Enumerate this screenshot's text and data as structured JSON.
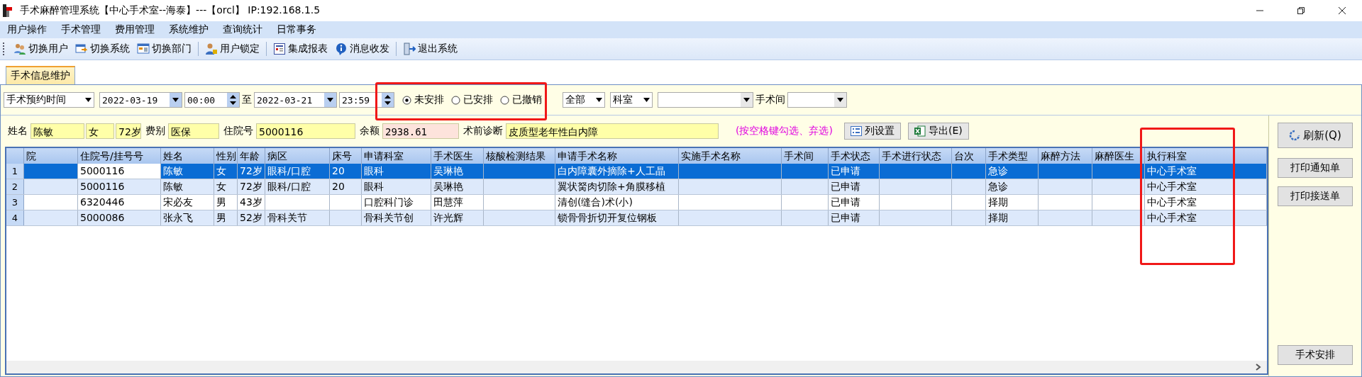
{
  "window": {
    "title": "手术麻醉管理系统【中心手术室--海泰】---【orcl】 IP:192.168.1.5"
  },
  "menu": [
    "用户操作",
    "手术管理",
    "费用管理",
    "系统维护",
    "查询统计",
    "日常事务"
  ],
  "toolbar": [
    {
      "kind": "users",
      "label": "切换用户"
    },
    {
      "kind": "system",
      "label": "切换系统"
    },
    {
      "kind": "dept",
      "label": "切换部门"
    },
    {
      "kind": "lock",
      "label": "用户锁定"
    },
    {
      "kind": "report",
      "label": "集成报表"
    },
    {
      "kind": "info",
      "label": "消息收发"
    },
    {
      "kind": "exit",
      "label": "退出系统"
    }
  ],
  "tabs": [
    {
      "label": "手术信息维护",
      "selected": true
    }
  ],
  "filter": {
    "time_type": "手术预约时间",
    "start_date": "2022-03-19",
    "start_time": "00:00",
    "to": "至",
    "end_date": "2022-03-21",
    "end_time": "23:59",
    "statuses": [
      {
        "label": "未安排",
        "selected": true
      },
      {
        "label": "已安排",
        "selected": false
      },
      {
        "label": "已撤销",
        "selected": false
      }
    ],
    "scope": "全部",
    "dept_type": "科室",
    "room_label": "手术间"
  },
  "patient": [
    {
      "kind": "label",
      "text": "姓名"
    },
    {
      "kind": "field",
      "text": "陈敏"
    },
    {
      "kind": "field",
      "text": "女"
    },
    {
      "kind": "field",
      "text": "72岁"
    },
    {
      "kind": "label",
      "text": "费别"
    },
    {
      "kind": "field",
      "text": "医保"
    },
    {
      "kind": "label",
      "text": "住院号"
    },
    {
      "kind": "field",
      "text": "5000116"
    },
    {
      "kind": "label",
      "text": "余额"
    },
    {
      "kind": "warn",
      "text": "2938.61"
    },
    {
      "kind": "label",
      "text": "术前诊断"
    },
    {
      "kind": "wide",
      "text": "皮质型老年性白内障"
    }
  ],
  "hint": "(按空格键勾选、弃选)",
  "actions": [
    {
      "kind": "columns",
      "label": "列设置"
    },
    {
      "kind": "excel",
      "label": "导出(E)"
    }
  ],
  "table": {
    "columns": [
      "院",
      "住院号/挂号号",
      "姓名",
      "性别",
      "年龄",
      "病区",
      "床号",
      "申请科室",
      "手术医生",
      "核酸检测结果",
      "申请手术名称",
      "实施手术名称",
      "手术间",
      "手术状态",
      "手术进行状态",
      "台次",
      "手术类型",
      "麻醉方法",
      "麻醉医生",
      "执行科室"
    ],
    "rows": [
      {
        "index": "1",
        "selected": true,
        "cells": [
          null,
          "5000116",
          "陈敏",
          "女",
          "72岁",
          "眼科/口腔",
          "20",
          "眼科",
          "吴琳艳",
          null,
          "白内障囊外摘除+人工晶",
          null,
          null,
          "已申请",
          null,
          null,
          "急诊",
          null,
          null,
          "中心手术室"
        ]
      },
      {
        "index": "2",
        "selected": false,
        "cells": [
          null,
          "5000116",
          "陈敏",
          "女",
          "72岁",
          "眼科/口腔",
          "20",
          "眼科",
          "吴琳艳",
          null,
          "翼状胬肉切除+角膜移植",
          null,
          null,
          "已申请",
          null,
          null,
          "急诊",
          null,
          null,
          "中心手术室"
        ]
      },
      {
        "index": "3",
        "selected": false,
        "cells": [
          null,
          "6320446",
          "宋必友",
          "男",
          "43岁",
          null,
          null,
          "口腔科门诊",
          "田慧萍",
          null,
          "清创(缝合)术(小)",
          null,
          null,
          "已申请",
          null,
          null,
          "择期",
          null,
          null,
          "中心手术室"
        ]
      },
      {
        "index": "4",
        "selected": false,
        "cells": [
          null,
          "5000086",
          "张永飞",
          "男",
          "52岁",
          "骨科关节",
          null,
          "骨科关节创",
          "许光辉",
          null,
          "锁骨骨折切开复位钢板",
          null,
          null,
          "已申请",
          null,
          null,
          "择期",
          null,
          null,
          "中心手术室"
        ]
      }
    ]
  },
  "side_buttons": [
    {
      "kind": "refresh",
      "label": "刷新(Q)"
    },
    {
      "kind": "plain",
      "label": "打印通知单"
    },
    {
      "kind": "plain",
      "label": "打印接送单"
    }
  ],
  "bottom_button": "手术安排"
}
